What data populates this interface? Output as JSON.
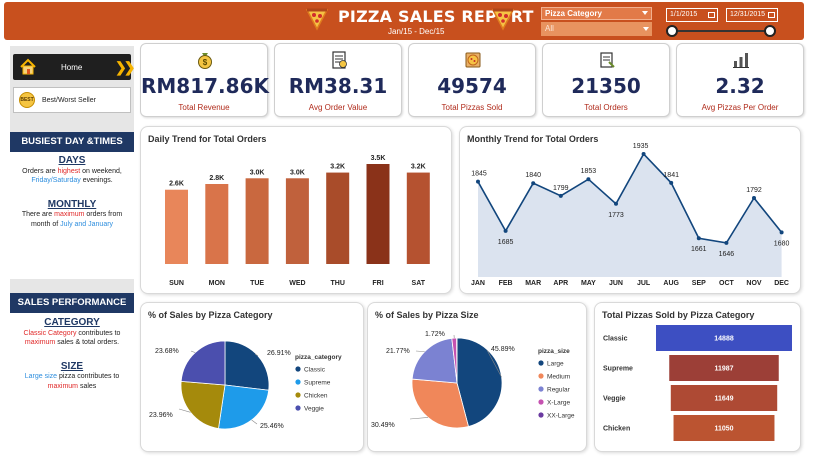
{
  "header": {
    "title": "PIZZA SALES REPORT",
    "subtitle": "Jan/15 - Dec/15",
    "category_filter_label": "Pizza Category",
    "category_filter_value": "All",
    "date_start": "1/1/2015",
    "date_end": "12/31/2015"
  },
  "nav": {
    "home_label": "Home",
    "best_label": "Best/Worst Seller",
    "best_badge": "BEST"
  },
  "busiest": {
    "heading": "BUSIEST DAY &TIMES",
    "days_title": "DAYS",
    "days_t1": "Orders are ",
    "days_t2": "highest",
    "days_t3": " on weekend, ",
    "days_t4": "Friday/Saturday",
    "days_t5": " evenings.",
    "monthly_title": "MONTHLY",
    "monthly_t1": "There are ",
    "monthly_t2": "maximum",
    "monthly_t3": " orders from month of ",
    "monthly_t4": "July and January"
  },
  "performance": {
    "heading": "SALES PERFORMANCE",
    "category_title": "CATEGORY",
    "cat_t1": "Classic Category",
    "cat_t2": " contributes to ",
    "cat_t3": "maximum",
    "cat_t4": " sales & total orders.",
    "size_title": "SIZE",
    "size_t1": "Large size",
    "size_t2": " pizza contributes to ",
    "size_t3": "maximum",
    "size_t4": " sales"
  },
  "kpis": [
    {
      "value": "RM817.86K",
      "label": "Total Revenue",
      "icon": "money-bag-icon"
    },
    {
      "value": "RM38.31",
      "label": "Avg Order Value",
      "icon": "receipt-icon"
    },
    {
      "value": "49574",
      "label": "Total Pizzas Sold",
      "icon": "pizza-box-icon"
    },
    {
      "value": "21350",
      "label": "Total Orders",
      "icon": "order-list-icon"
    },
    {
      "value": "2.32",
      "label": "Avg Pizzas Per Order",
      "icon": "bar-chart-icon"
    }
  ],
  "colors": {
    "header": "#c8501e",
    "navy": "#1f3864",
    "kpi_value": "#1f2a5a",
    "kpi_label": "#b02a1a"
  },
  "chart_data": [
    {
      "id": "daily",
      "type": "bar",
      "title": "Daily Trend for Total Orders",
      "categories": [
        "SUN",
        "MON",
        "TUE",
        "WED",
        "THU",
        "FRI",
        "SAT"
      ],
      "values": [
        2.6,
        2.8,
        3.0,
        3.0,
        3.2,
        3.5,
        3.2
      ],
      "labels": [
        "2.6K",
        "2.8K",
        "3.0K",
        "3.0K",
        "3.2K",
        "3.5K",
        "3.2K"
      ],
      "colors": [
        "#e8865a",
        "#d9744a",
        "#c9683f",
        "#c0613c",
        "#a94c2a",
        "#8a3219",
        "#b55230"
      ],
      "ylim": [
        0,
        3.5
      ]
    },
    {
      "id": "monthly",
      "type": "area",
      "title": "Monthly Trend for Total Orders",
      "categories": [
        "JAN",
        "FEB",
        "MAR",
        "APR",
        "MAY",
        "JUN",
        "JUL",
        "AUG",
        "SEP",
        "OCT",
        "NOV",
        "DEC"
      ],
      "values": [
        1845,
        1685,
        1840,
        1799,
        1853,
        1773,
        1935,
        1841,
        1661,
        1646,
        1792,
        1680
      ],
      "ylim": [
        1600,
        1935
      ]
    },
    {
      "id": "category",
      "type": "pie",
      "title": "% of Sales by Pizza Category",
      "legend_title": "pizza_category",
      "slices": [
        {
          "name": "Classic",
          "value": 26.91,
          "label": "26.91%",
          "color": "#12467d"
        },
        {
          "name": "Supreme",
          "value": 25.46,
          "label": "25.46%",
          "color": "#1e9bea"
        },
        {
          "name": "Chicken",
          "value": 23.96,
          "label": "23.96%",
          "color": "#a58a0c"
        },
        {
          "name": "Veggie",
          "value": 23.68,
          "label": "23.68%",
          "color": "#4b4fae"
        }
      ]
    },
    {
      "id": "size",
      "type": "pie",
      "title": "% of Sales by Pizza Size",
      "legend_title": "pizza_size",
      "slices": [
        {
          "name": "Large",
          "value": 45.89,
          "label": "45.89%",
          "color": "#12467d"
        },
        {
          "name": "Medium",
          "value": 30.49,
          "label": "30.49%",
          "color": "#f0875a"
        },
        {
          "name": "Regular",
          "value": 21.77,
          "label": "21.77%",
          "color": "#7b82d2"
        },
        {
          "name": "X-Large",
          "value": 1.72,
          "label": "1.72%",
          "color": "#c552b0"
        },
        {
          "name": "XX-Large",
          "value": 0.12,
          "label": "",
          "color": "#6a3aa0"
        }
      ]
    },
    {
      "id": "funnel",
      "type": "bar",
      "title": "Total Pizzas Sold by Pizza Category",
      "categories": [
        "Classic",
        "Supreme",
        "Veggie",
        "Chicken"
      ],
      "values": [
        14888,
        11987,
        11649,
        11050
      ],
      "colors": [
        "#3d4fc2",
        "#9c3f37",
        "#ae4a34",
        "#bb5431"
      ]
    }
  ]
}
